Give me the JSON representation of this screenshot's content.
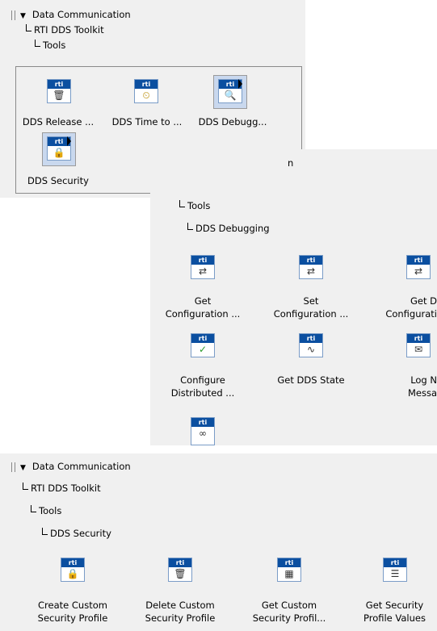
{
  "top": {
    "tree": [
      "Data Communication",
      "RTI DDS Toolkit",
      "Tools"
    ],
    "items": [
      {
        "label": "DDS Release ...",
        "glyph": "🗑",
        "icon": "trash-icon"
      },
      {
        "label": "DDS Time to ...",
        "glyph": "⏲",
        "icon": "time-convert-icon"
      },
      {
        "label": "DDS Debugg...",
        "glyph": "🔍",
        "icon": "debugging-icon"
      },
      {
        "label": "DDS Security",
        "glyph": "🔒",
        "icon": "lock-icon"
      }
    ]
  },
  "middle": {
    "tree_partial": "n",
    "tree": [
      "Tools",
      "DDS Debugging"
    ],
    "items": [
      {
        "label_line1": "Get",
        "label_line2": "Configuration ...",
        "glyph": "⇄",
        "icon": "get-config-icon"
      },
      {
        "label_line1": "Set",
        "label_line2": "Configuration ...",
        "glyph": "⇄",
        "icon": "set-config-icon"
      },
      {
        "label_line1": "Get D",
        "label_line2": "Configurati",
        "glyph": "⇄",
        "icon": "get-dist-config-icon"
      },
      {
        "label_line1": "Configure",
        "label_line2": "Distributed ...",
        "glyph": "✓",
        "icon": "configure-distributed-icon"
      },
      {
        "label_line1": "Get DDS State",
        "label_line2": "",
        "glyph": "∿",
        "icon": "state-icon"
      },
      {
        "label_line1": "Log N",
        "label_line2": "Messa",
        "glyph": "✉",
        "icon": "log-icon"
      },
      {
        "label_line1": "",
        "label_line2": "",
        "glyph": "∞",
        "icon": "monitor-icon"
      }
    ]
  },
  "bottom": {
    "tree": [
      "Data Communication",
      "RTI DDS Toolkit",
      "Tools",
      "DDS Security"
    ],
    "items": [
      {
        "label_line1": "Create Custom",
        "label_line2": "Security Profile",
        "glyph": "🔒",
        "icon": "create-profile-icon"
      },
      {
        "label_line1": "Delete Custom",
        "label_line2": "Security Profile",
        "glyph": "🗑",
        "icon": "delete-profile-icon"
      },
      {
        "label_line1": "Get Custom",
        "label_line2": "Security Profil...",
        "glyph": "▦",
        "icon": "get-profile-icon"
      },
      {
        "label_line1": "Get Security",
        "label_line2": "Profile Values",
        "glyph": "☰",
        "icon": "profile-values-icon"
      }
    ]
  },
  "icon_badge": "rti"
}
